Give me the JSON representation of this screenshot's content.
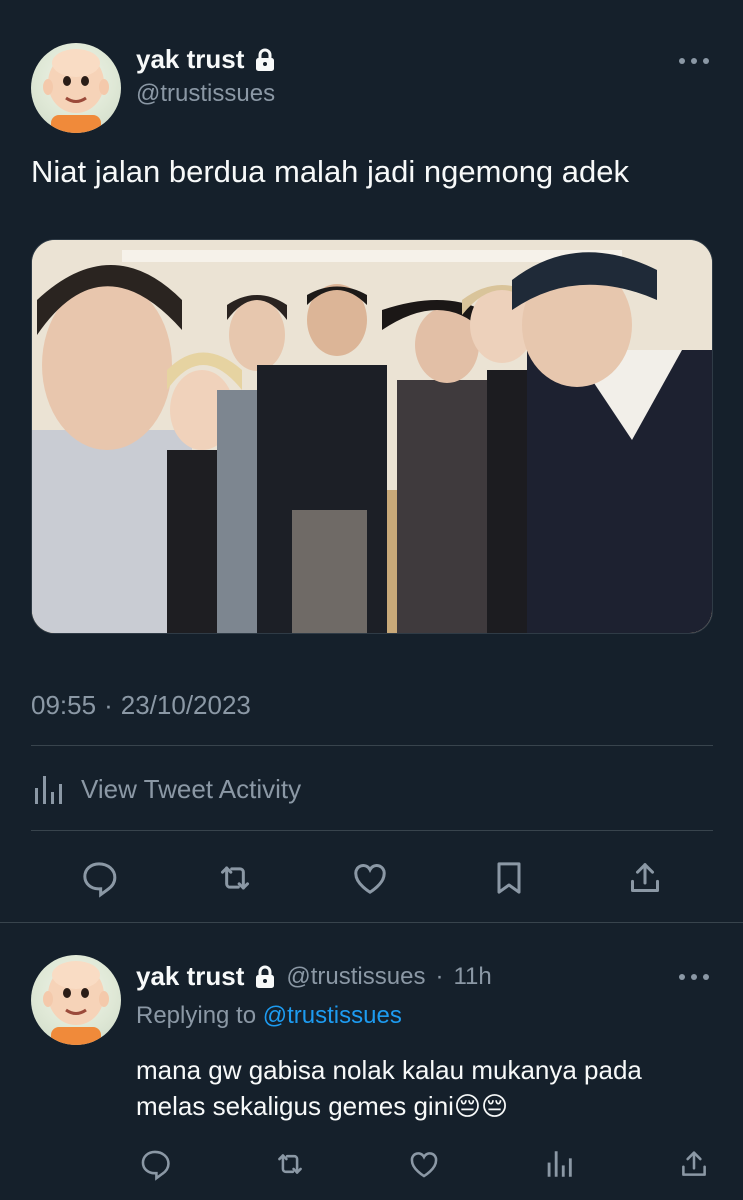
{
  "tweet": {
    "author_name": "yak trust",
    "author_handle": "@trustissues",
    "text": "Niat jalan berdua malah jadi ngemong adek",
    "time": "09:55",
    "date": "23/10/2023",
    "separator": "·",
    "view_activity_label": "View Tweet Activity"
  },
  "reply": {
    "author_name": "yak trust",
    "author_handle": "@trustissues",
    "time_ago": "11h",
    "separator": "·",
    "replying_prefix": "Replying to",
    "replying_handle": "@trustissues",
    "text_line1": "mana gw gabisa nolak kalau mukanya pada",
    "text_line2": "melas sekaligus gemes gini😔😔"
  },
  "icons": {
    "lock": "lock-icon",
    "more": "more-icon",
    "reply": "reply-icon",
    "retweet": "retweet-icon",
    "like": "heart-icon",
    "bookmark": "bookmark-icon",
    "share": "share-icon",
    "analytics": "analytics-icon"
  },
  "colors": {
    "background": "#15202b",
    "text_primary": "#f7f9f9",
    "text_secondary": "#8b98a5",
    "link": "#1d9bf0",
    "divider": "#38444d"
  }
}
